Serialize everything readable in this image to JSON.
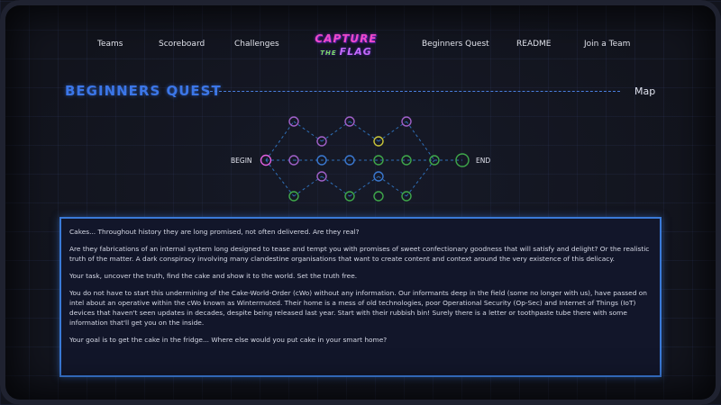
{
  "nav": {
    "teams": "Teams",
    "scoreboard": "Scoreboard",
    "challenges": "Challenges",
    "beginners_quest": "Beginners Quest",
    "readme": "README",
    "join": "Join a Team"
  },
  "logo": {
    "line1": "CAPTURE",
    "line2_small": "THE",
    "line2": "FLAG"
  },
  "page": {
    "title": "BEGINNERS QUEST",
    "map_label": "Map"
  },
  "map": {
    "begin": "BEGIN",
    "end": "END"
  },
  "story": {
    "p1": "Cakes... Throughout history they are long promised, not often delivered. Are they real?",
    "p2": "Are they fabrications of an internal system long designed to tease and tempt you with promises of sweet confectionary goodness that will satisfy and delight? Or the realistic truth of the matter. A dark conspiracy involving many clandestine organisations that want to create content and context around the very existence of this delicacy.",
    "p3": "Your task, uncover the truth, find the cake and show it to the world. Set the truth free.",
    "p4": "You do not have to start this undermining of the Cake-World-Order (cWo) without any information. Our informants deep in the field (some no longer with us), have passed on intel about an operative within the cWo known as Wintermuted. Their home is a mess of old technologies, poor Operational Security (Op-Sec) and Internet of Things (IoT) devices that haven't seen updates in decades, despite being released last year. Start with their rubbish bin! Surely there is a letter or toothpaste tube there with some information that'll get you on the inside.",
    "p5": "Your goal is to get the cake in the fridge... Where else would you put cake in your smart home?"
  },
  "colors": {
    "accent": "#3b76e8",
    "purple": "#a060c8",
    "blue": "#3a78d0",
    "green": "#3fa84a",
    "yellow": "#c8c43a",
    "pink": "#e060e0"
  }
}
